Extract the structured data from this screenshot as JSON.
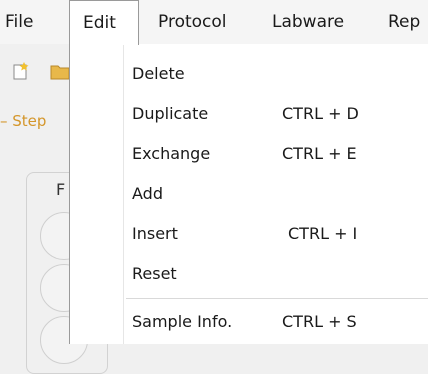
{
  "menubar": {
    "items": [
      {
        "label": "File"
      },
      {
        "label": "Edit",
        "active": true
      },
      {
        "label": "Protocol"
      },
      {
        "label": "Labware"
      },
      {
        "label": "Rep"
      }
    ]
  },
  "background": {
    "steps_label": "Step",
    "group_letter": "F"
  },
  "edit_menu": {
    "items": [
      {
        "label": "Delete",
        "shortcut": ""
      },
      {
        "label": "Duplicate",
        "shortcut": "CTRL + D"
      },
      {
        "label": "Exchange",
        "shortcut": "CTRL + E"
      },
      {
        "label": "Add",
        "shortcut": ""
      },
      {
        "label": "Insert",
        "shortcut": "CTRL + I"
      },
      {
        "label": "Reset",
        "shortcut": ""
      },
      {
        "label": "Sample Info.",
        "shortcut": "CTRL + S"
      }
    ]
  },
  "colors": {
    "accent_orange": "#d4962a",
    "menu_border": "#9a9a9a"
  },
  "icons": [
    "new-file-icon",
    "open-folder-icon"
  ]
}
